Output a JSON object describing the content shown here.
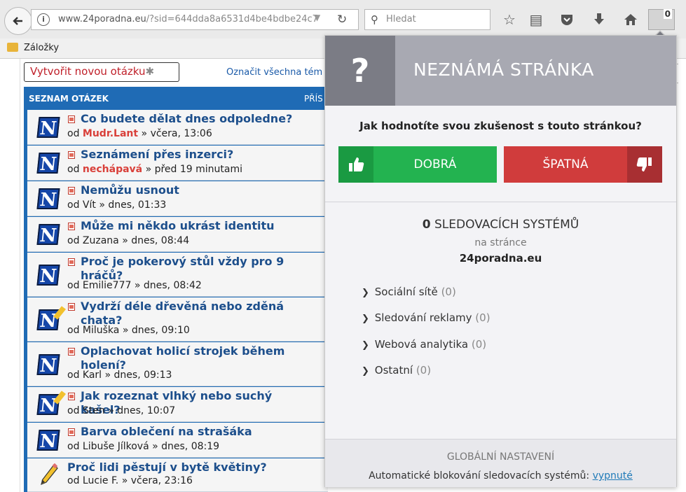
{
  "browser": {
    "url_host": "www.24poradna.eu",
    "url_rest": "/?sid=644dda8a6531d4be4bdbe24c7",
    "search_placeholder": "Hledat",
    "extension_badge": "0",
    "bookmarks_label": "Záložky"
  },
  "page": {
    "new_question_label": "Vytvořit novou otázku",
    "new_question_star": "✱",
    "mark_all": "Označit všechna tém",
    "list_header": "SEZNAM OTÁZEK",
    "list_header_right": "PŘÍS",
    "questions": [
      {
        "title": "Co budete dělat dnes odpoledne?",
        "by": "od",
        "user": "Mudr.Lant",
        "user_red": true,
        "time": "» včera, 13:06",
        "icon": "n"
      },
      {
        "title": "Seznámení přes inzerci?",
        "by": "od",
        "user": "nechápavá",
        "user_red": true,
        "time": "» před 19 minutami",
        "icon": "n"
      },
      {
        "title": "Nemůžu usnout",
        "by": "od",
        "user": "Vít",
        "user_red": false,
        "time": "» dnes, 01:33",
        "icon": "n"
      },
      {
        "title": "Může mi někdo ukrást identitu",
        "by": "od",
        "user": "Zuzana",
        "user_red": false,
        "time": "» dnes, 08:44",
        "icon": "n"
      },
      {
        "title": "Proč je pokerový stůl vždy pro 9 hráčů?",
        "by": "od",
        "user": "Emilie777",
        "user_red": false,
        "time": "» dnes, 08:42",
        "icon": "n"
      },
      {
        "title": "Vydrží déle dřevěná nebo zděná chata?",
        "by": "od",
        "user": "Miluška",
        "user_red": false,
        "time": "» dnes, 09:10",
        "icon": "n-pen"
      },
      {
        "title": "Oplachovat holicí strojek během holení?",
        "by": "od",
        "user": "Karl",
        "user_red": false,
        "time": "» dnes, 09:13",
        "icon": "n"
      },
      {
        "title": "Jak rozeznat vlhký nebo suchý kašel?",
        "by": "od",
        "user": "Sten",
        "user_red": false,
        "time": "» dnes, 10:07",
        "icon": "n-pen"
      },
      {
        "title": "Barva oblečení na strašáka",
        "by": "od",
        "user": "Libuše Jílková",
        "user_red": false,
        "time": "» dnes, 08:19",
        "icon": "n"
      },
      {
        "title": "Proč lidi pěstují v bytě květiny?",
        "by": "od",
        "user": "Lucie F.",
        "user_red": false,
        "time": "» včera, 23:16",
        "icon": "pencil"
      }
    ]
  },
  "popup": {
    "question_mark": "?",
    "title": "NEZNÁMÁ STRÁNKA",
    "rating_question": "Jak hodnotíte svou zkušenost s touto stránkou?",
    "good_label": "DOBRÁ",
    "bad_label": "ŠPATNÁ",
    "tracker_count": "0",
    "tracker_label": "SLEDOVACÍCH SYSTÉMŮ",
    "on_page": "na stránce",
    "domain": "24poradna.eu",
    "categories": [
      {
        "label": "Sociální sítě",
        "count": "(0)"
      },
      {
        "label": "Sledování reklamy",
        "count": "(0)"
      },
      {
        "label": "Webová analytika",
        "count": "(0)"
      },
      {
        "label": "Ostatní",
        "count": "(0)"
      }
    ],
    "global_settings": "GLOBÁLNÍ NASTAVENÍ",
    "auto_block": "Automatické blokování sledovacích systémů:",
    "auto_block_state": "vypnuté"
  },
  "colors": {
    "good": "#23b350",
    "bad": "#d03c3c",
    "header": "#a8a9b2",
    "list_blue": "#1f6bb5"
  }
}
